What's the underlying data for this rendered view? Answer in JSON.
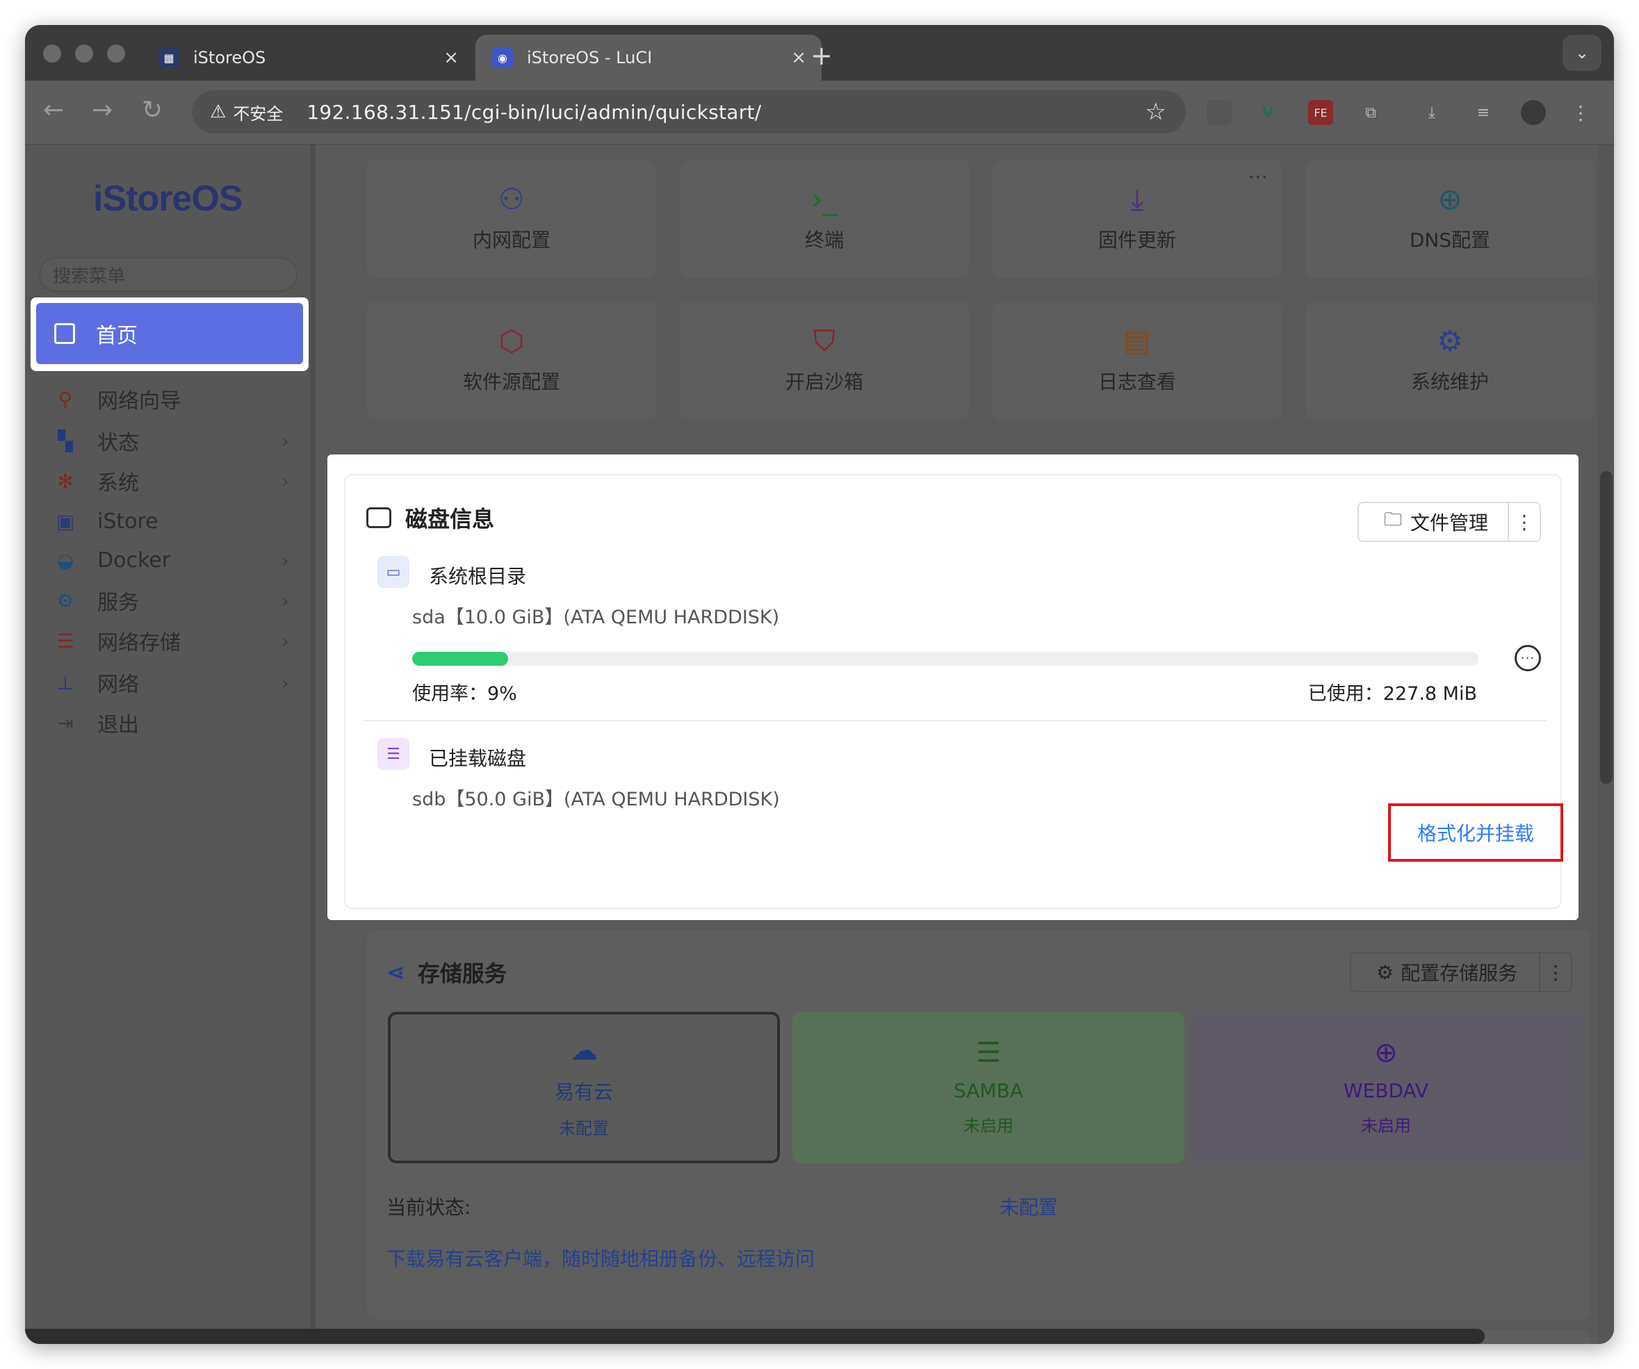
{
  "browser": {
    "tabs": [
      {
        "title": "iStoreOS",
        "close": "×"
      },
      {
        "title": "iStoreOS - LuCI",
        "close": "×"
      }
    ],
    "new_tab": "+",
    "insecure_label": "不安全",
    "url": "192.168.31.151/cgi-bin/luci/admin/quickstart/"
  },
  "sidebar": {
    "logo": "iStoreOS",
    "search_placeholder": "搜索菜单",
    "home": "首页",
    "items": [
      {
        "label": "网络向导",
        "icon": "wizard-icon",
        "has_submenu": false
      },
      {
        "label": "状态",
        "icon": "dashboard-icon",
        "has_submenu": true
      },
      {
        "label": "系统",
        "icon": "gear-icon",
        "has_submenu": true
      },
      {
        "label": "iStore",
        "icon": "store-icon",
        "has_submenu": false
      },
      {
        "label": "Docker",
        "icon": "docker-icon",
        "has_submenu": true
      },
      {
        "label": "服务",
        "icon": "services-icon",
        "has_submenu": true
      },
      {
        "label": "网络存储",
        "icon": "storage-icon",
        "has_submenu": true
      },
      {
        "label": "网络",
        "icon": "network-icon",
        "has_submenu": true
      },
      {
        "label": "退出",
        "icon": "logout-icon",
        "has_submenu": false
      }
    ]
  },
  "quick_tiles": [
    {
      "label": "内网配置",
      "icon": "lan-icon",
      "color": "#2c3f88"
    },
    {
      "label": "终端",
      "icon": "terminal-icon",
      "color": "#1f6d2a"
    },
    {
      "label": "固件更新",
      "icon": "download-icon",
      "color": "#4b2d8c"
    },
    {
      "label": "DNS配置",
      "icon": "globe-icon",
      "color": "#1c5a6b"
    },
    {
      "label": "软件源配置",
      "icon": "package-icon",
      "color": "#8a2432"
    },
    {
      "label": "开启沙箱",
      "icon": "shield-icon",
      "color": "#8a1f1f"
    },
    {
      "label": "日志查看",
      "icon": "log-icon",
      "color": "#8a4a14"
    },
    {
      "label": "系统维护",
      "icon": "settings-icon",
      "color": "#2c3f88"
    }
  ],
  "disk_info": {
    "title": "磁盘信息",
    "file_manager": "文件管理",
    "root": {
      "title": "系统根目录",
      "device": "sda【10.0 GiB】(ATA QEMU HARDDISK)",
      "usage_percent": 9,
      "usage_label": "使用率：",
      "usage_value": "9%",
      "used_label": "已使用：",
      "used_value": "227.8 MiB"
    },
    "mounted": {
      "title": "已挂载磁盘",
      "device": "sdb【50.0 GiB】(ATA QEMU HARDDISK)",
      "action": "格式化并挂载"
    }
  },
  "storage_service": {
    "title": "存储服务",
    "config_button": "配置存储服务",
    "services": [
      {
        "name": "易有云",
        "status": "未配置",
        "icon": "cloud-icon",
        "selected": true
      },
      {
        "name": "SAMBA",
        "status": "未启用",
        "icon": "server-icon",
        "selected": false
      },
      {
        "name": "WEBDAV",
        "status": "未启用",
        "icon": "globe-icon",
        "selected": false
      }
    ],
    "current_status_label": "当前状态:",
    "current_status_value": "未配置",
    "download_link": "下载易有云客户端，随时随地相册备份、远程访问"
  },
  "colors": {
    "accent": "#5b6fe3",
    "progress": "#2ecc71",
    "highlight_border": "#e0161b",
    "link": "#2e7cf6"
  }
}
